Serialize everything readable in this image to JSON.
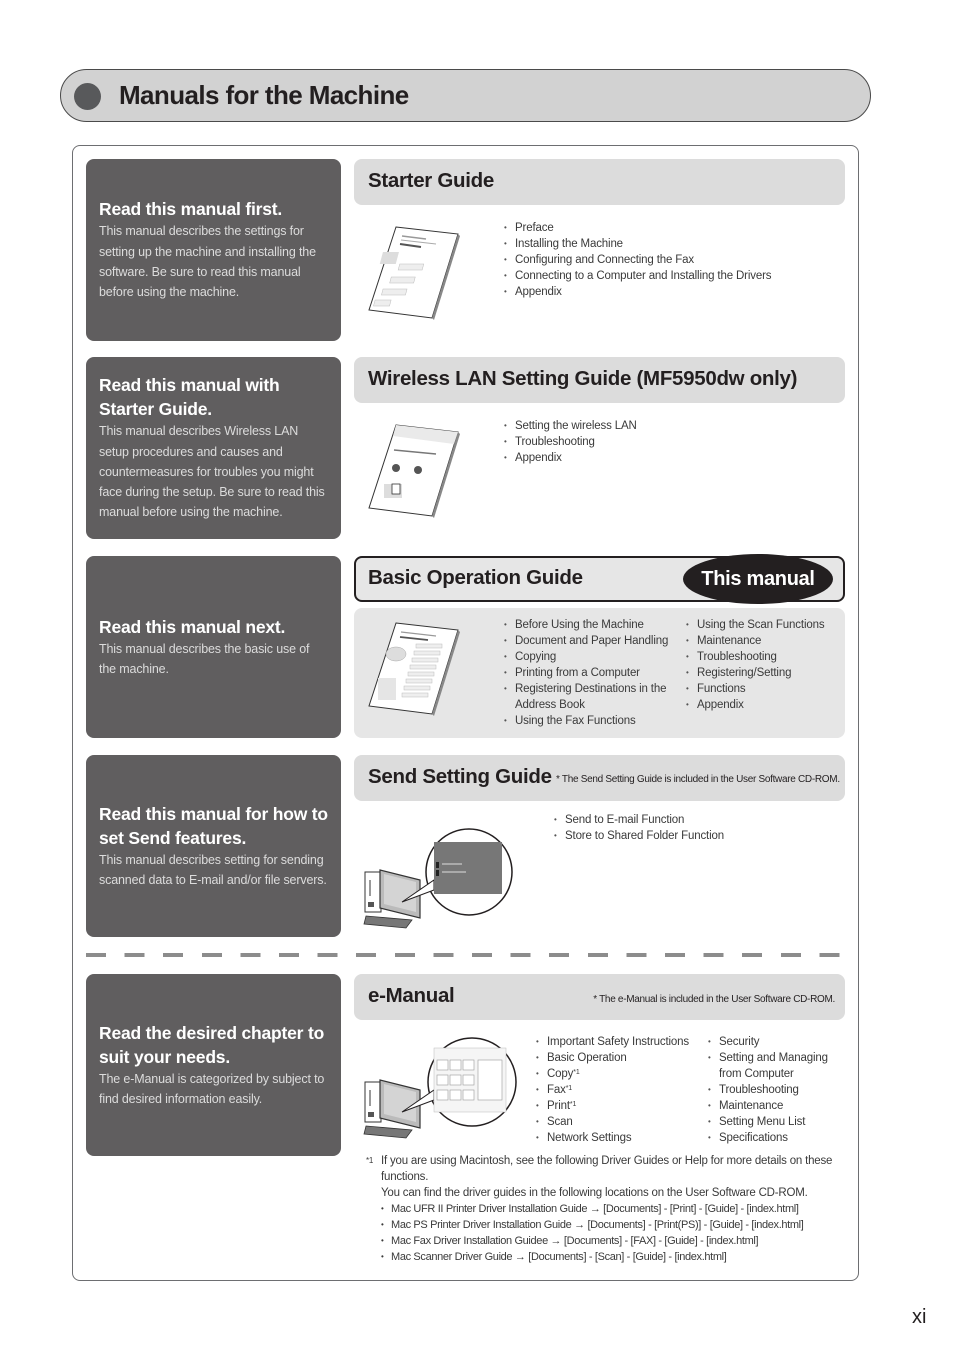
{
  "page": {
    "title": "Manuals for the Machine",
    "page_number": "xi"
  },
  "sections": [
    {
      "left_heading": "Read this manual first.",
      "left_description": "This manual describes the settings for setting up the machine and installing the software. Be sure to read this manual before using the machine.",
      "guide_title": "Starter Guide",
      "illustration": "starter-guide-book-icon",
      "items": [
        "Preface",
        "Installing the Machine",
        "Configuring and Connecting the Fax",
        "Connecting to a Computer and Installing the Drivers",
        "Appendix"
      ]
    },
    {
      "left_heading": "Read this manual with Starter Guide.",
      "left_description": "This manual describes Wireless LAN setup procedures and causes and countermeasures for troubles you might face during the setup. Be sure to read this manual before using the machine.",
      "guide_title": "Wireless LAN Setting Guide (MF5950dw only)",
      "illustration": "wireless-lan-guide-book-icon",
      "items": [
        "Setting the wireless LAN",
        "Troubleshooting",
        "Appendix"
      ]
    },
    {
      "left_heading": "Read this manual next.",
      "left_description": "This manual describes the basic use of the machine.",
      "guide_title": "Basic Operation Guide",
      "badge": "This manual",
      "illustration": "basic-operation-guide-book-icon",
      "items_col1": [
        "Before Using the Machine",
        "Document and Paper Handling",
        "Copying",
        "Printing from a Computer",
        "Registering Destinations in the Address Book",
        "Using the Fax Functions"
      ],
      "items_col2": [
        "Using the Scan Functions",
        "Maintenance",
        "Troubleshooting",
        "Registering/Setting",
        "Functions",
        "Appendix"
      ]
    },
    {
      "left_heading": "Read this manual for how to set Send features.",
      "left_description": "This manual describes setting for sending scanned data to E-mail and/or file servers.",
      "guide_title": "Send Setting Guide",
      "note": "* The Send Setting Guide is included in the User Software CD-ROM.",
      "illustration": "computer-screen-icon",
      "items": [
        "Send to E-mail Function",
        "Store to Shared Folder Function"
      ]
    },
    {
      "left_heading": "Read the desired chapter to suit your needs.",
      "left_description": "The e-Manual is categorized by subject to find desired information easily.",
      "guide_title": "e-Manual",
      "note": "* The e-Manual is included in the User Software CD-ROM.",
      "illustration": "computer-screen-icon",
      "items_col1": [
        "Important Safety Instructions",
        "Basic Operation",
        "Copy",
        "Fax",
        "Print",
        "Scan",
        "Network Settings"
      ],
      "items_col1_marks": [
        "",
        "",
        "*1",
        "*1",
        "*1",
        "",
        ""
      ],
      "items_col2": [
        "Security",
        "Setting and Managing from Computer",
        "Troubleshooting",
        "Maintenance",
        "Setting Menu List",
        "Specifications"
      ]
    }
  ],
  "footnote": {
    "mark": "*1",
    "text1": "If you are using Macintosh, see the following Driver Guides or Help for more details on these functions.",
    "text2": "You can find the driver guides in the following locations on the User Software CD-ROM.",
    "paths": [
      "Mac UFR II Printer Driver Installation Guide → [Documents] - [Print] - [Guide] - [index.html]",
      "Mac PS Printer Driver Installation Guide → [Documents] - [Print(PS)] - [Guide] - [index.html]",
      "Mac Fax Driver Installation Guidee → [Documents] - [FAX] - [Guide] - [index.html]",
      "Mac Scanner Driver Guide → [Documents] - [Scan] - [Guide] - [index.html]"
    ]
  }
}
